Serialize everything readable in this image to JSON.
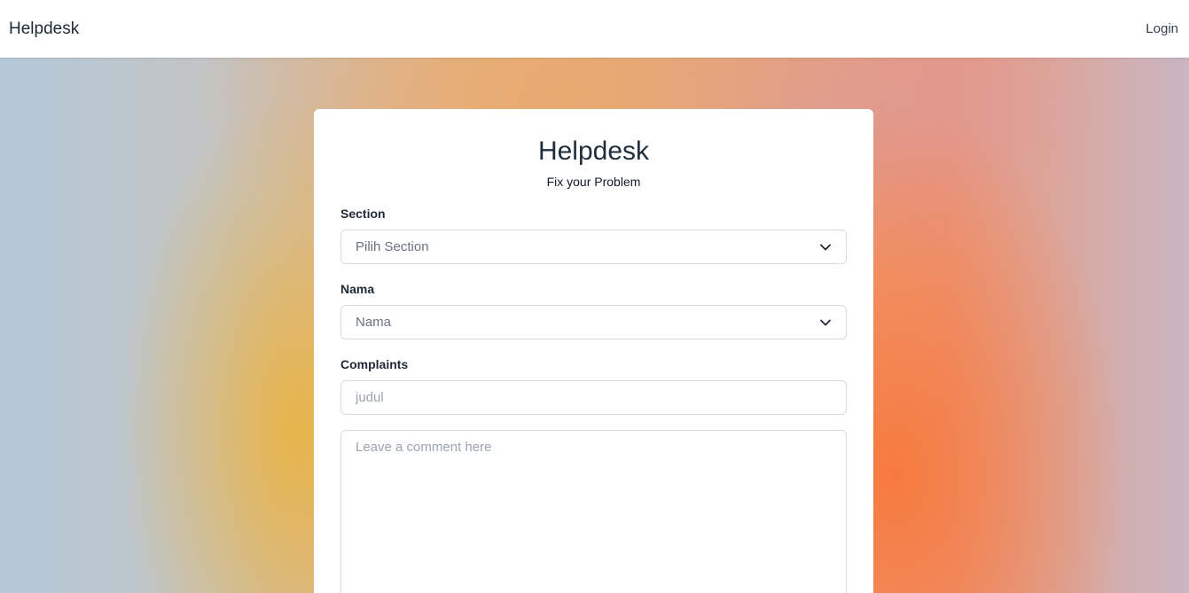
{
  "navbar": {
    "brand": "Helpdesk",
    "login_label": "Login"
  },
  "form": {
    "title": "Helpdesk",
    "subtitle": "Fix your Problem",
    "section": {
      "label": "Section",
      "selected": "Pilih Section"
    },
    "nama": {
      "label": "Nama",
      "selected": "Nama"
    },
    "complaints": {
      "label": "Complaints",
      "title_placeholder": "judul",
      "comment_placeholder": "Leave a comment here"
    }
  },
  "icons": {
    "select_arrow": "chevron-down-icon"
  },
  "colors": {
    "navbar_bg": "#ffffff",
    "card_bg": "#ffffff",
    "gradient_orange": "#f7783c",
    "gradient_yellow": "#e8b446",
    "gradient_blue": "#b4c8d8"
  }
}
